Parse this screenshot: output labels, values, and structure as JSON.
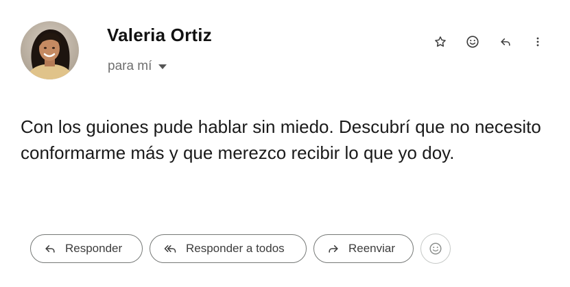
{
  "message": {
    "sender_name": "Valeria Ortiz",
    "recipient_label": "para mí",
    "body": "Con los guiones pude hablar sin miedo. Descubrí que no necesito conformarme más y que merezco recibir lo que yo doy."
  },
  "header_actions": [
    {
      "name": "star-icon",
      "label": "Destacar"
    },
    {
      "name": "emoji-reaction-icon",
      "label": "Agregar reacción"
    },
    {
      "name": "reply-icon",
      "label": "Responder"
    },
    {
      "name": "more-vert-icon",
      "label": "Más"
    }
  ],
  "footer_actions": {
    "reply_label": "Responder",
    "reply_all_label": "Responder a todos",
    "forward_label": "Reenviar"
  }
}
